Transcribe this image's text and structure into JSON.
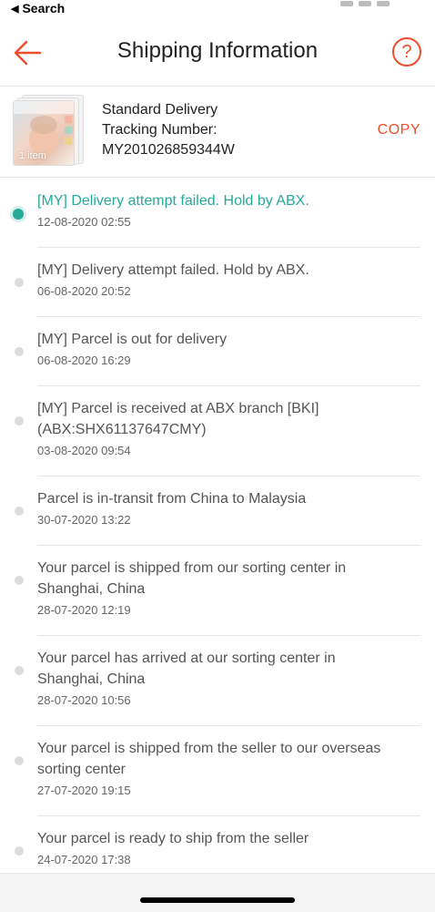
{
  "status_bar": {
    "back_label": "Search"
  },
  "header": {
    "title": "Shipping Information",
    "help_label": "?"
  },
  "shipment": {
    "thumbnail_badge": "1 item",
    "method": "Standard Delivery",
    "tracking_label": "Tracking Number:",
    "tracking_number": "MY201026859344W",
    "copy_label": "COPY"
  },
  "colors": {
    "accent": "#ee4d2d",
    "active": "#26aa99",
    "inactive_dot": "#dcdcdc"
  },
  "timeline": [
    {
      "event_lines": [
        "[MY] Delivery attempt failed. Hold by ABX."
      ],
      "time": "12-08-2020 02:55",
      "active": true
    },
    {
      "event_lines": [
        "[MY] Delivery attempt failed. Hold by ABX."
      ],
      "time": "06-08-2020 20:52",
      "active": false
    },
    {
      "event_lines": [
        "[MY] Parcel is out for delivery"
      ],
      "time": "06-08-2020 16:29",
      "active": false
    },
    {
      "event_lines": [
        "[MY] Parcel is received at ABX branch [BKI]",
        "(ABX:SHX61137647CMY)"
      ],
      "time": "03-08-2020 09:54",
      "active": false
    },
    {
      "event_lines": [
        "Parcel is in-transit from China to Malaysia"
      ],
      "time": "30-07-2020 13:22",
      "active": false
    },
    {
      "event_lines": [
        "Your parcel is shipped from our sorting center in",
        "Shanghai, China"
      ],
      "time": "28-07-2020 12:19",
      "active": false
    },
    {
      "event_lines": [
        "Your parcel has arrived at our sorting center in",
        "Shanghai, China"
      ],
      "time": "28-07-2020 10:56",
      "active": false
    },
    {
      "event_lines": [
        "Your parcel is shipped from the seller to our overseas",
        "sorting center"
      ],
      "time": "27-07-2020 19:15",
      "active": false
    },
    {
      "event_lines": [
        "Your parcel is ready to ship from the seller"
      ],
      "time": "24-07-2020 17:38",
      "active": false
    }
  ]
}
